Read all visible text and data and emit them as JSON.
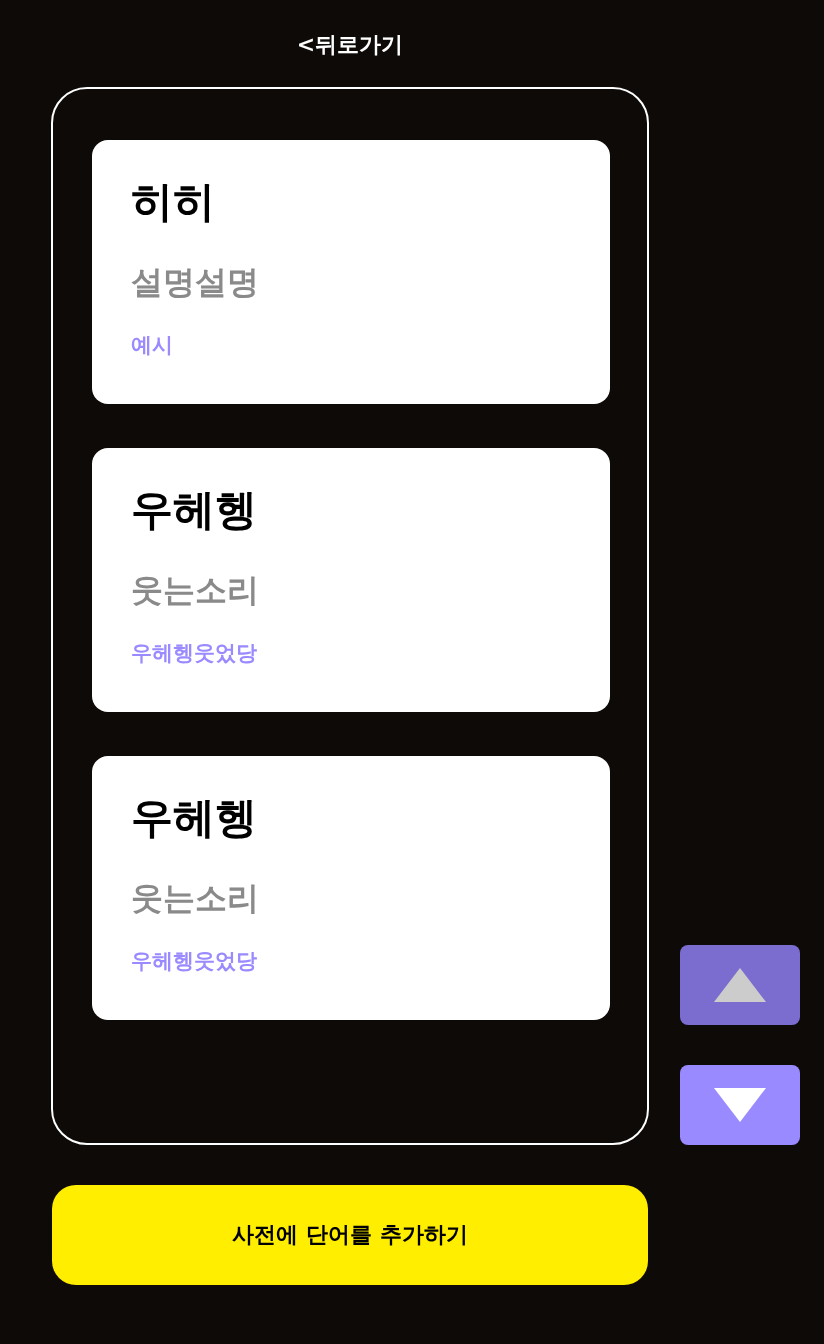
{
  "header": {
    "back_link": "<뒤로가기"
  },
  "word_cards": [
    {
      "word": "히히",
      "meaning": "설명설명",
      "example": "예시"
    },
    {
      "word": "우헤헹",
      "meaning": "웃는소리",
      "example": "우헤헹웃었당"
    },
    {
      "word": "우헤헹",
      "meaning": "웃는소리",
      "example": "우헤헹웃었당"
    }
  ],
  "scroll_buttons": [
    {
      "kind": "up",
      "disabled": true
    },
    {
      "kind": "down",
      "disabled": false
    }
  ],
  "add_button": {
    "label": "사전에 단어를 추가하기"
  }
}
